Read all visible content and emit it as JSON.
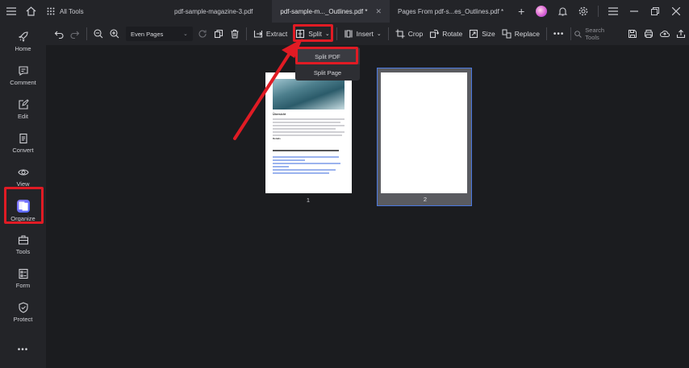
{
  "titlebar": {
    "all_tools": "All Tools",
    "tabs": [
      {
        "label": "pdf-sample-magazine-3.pdf",
        "active": false
      },
      {
        "label": "pdf-sample-m..._Outlines.pdf *",
        "active": true
      },
      {
        "label": "Pages From pdf-s...es_Outlines.pdf *",
        "active": false
      }
    ]
  },
  "sidebar": {
    "items": [
      {
        "label": "Home",
        "icon": "rocket-icon"
      },
      {
        "label": "Comment",
        "icon": "comment-icon"
      },
      {
        "label": "Edit",
        "icon": "edit-icon"
      },
      {
        "label": "Convert",
        "icon": "convert-icon"
      },
      {
        "label": "View",
        "icon": "eye-icon"
      },
      {
        "label": "Organize",
        "icon": "organize-icon"
      },
      {
        "label": "Tools",
        "icon": "toolbox-icon"
      },
      {
        "label": "Form",
        "icon": "form-icon"
      },
      {
        "label": "Protect",
        "icon": "shield-icon"
      }
    ],
    "more": "•••"
  },
  "toolbar": {
    "page_select": "Even Pages",
    "extract": "Extract",
    "split": "Split",
    "insert": "Insert",
    "crop": "Crop",
    "rotate": "Rotate",
    "size": "Size",
    "replace": "Replace",
    "search_placeholder": "Search Tools"
  },
  "split_menu": {
    "items": [
      "Split PDF",
      "Split Page"
    ]
  },
  "pages": [
    {
      "number": "1"
    },
    {
      "number": "2"
    }
  ],
  "page1_content": {
    "heading": "Übersicht",
    "bold_word": "Details"
  },
  "colors": {
    "highlight": "#e01b24",
    "selected_border": "#4a78e0",
    "accent": "#6b6cff"
  }
}
